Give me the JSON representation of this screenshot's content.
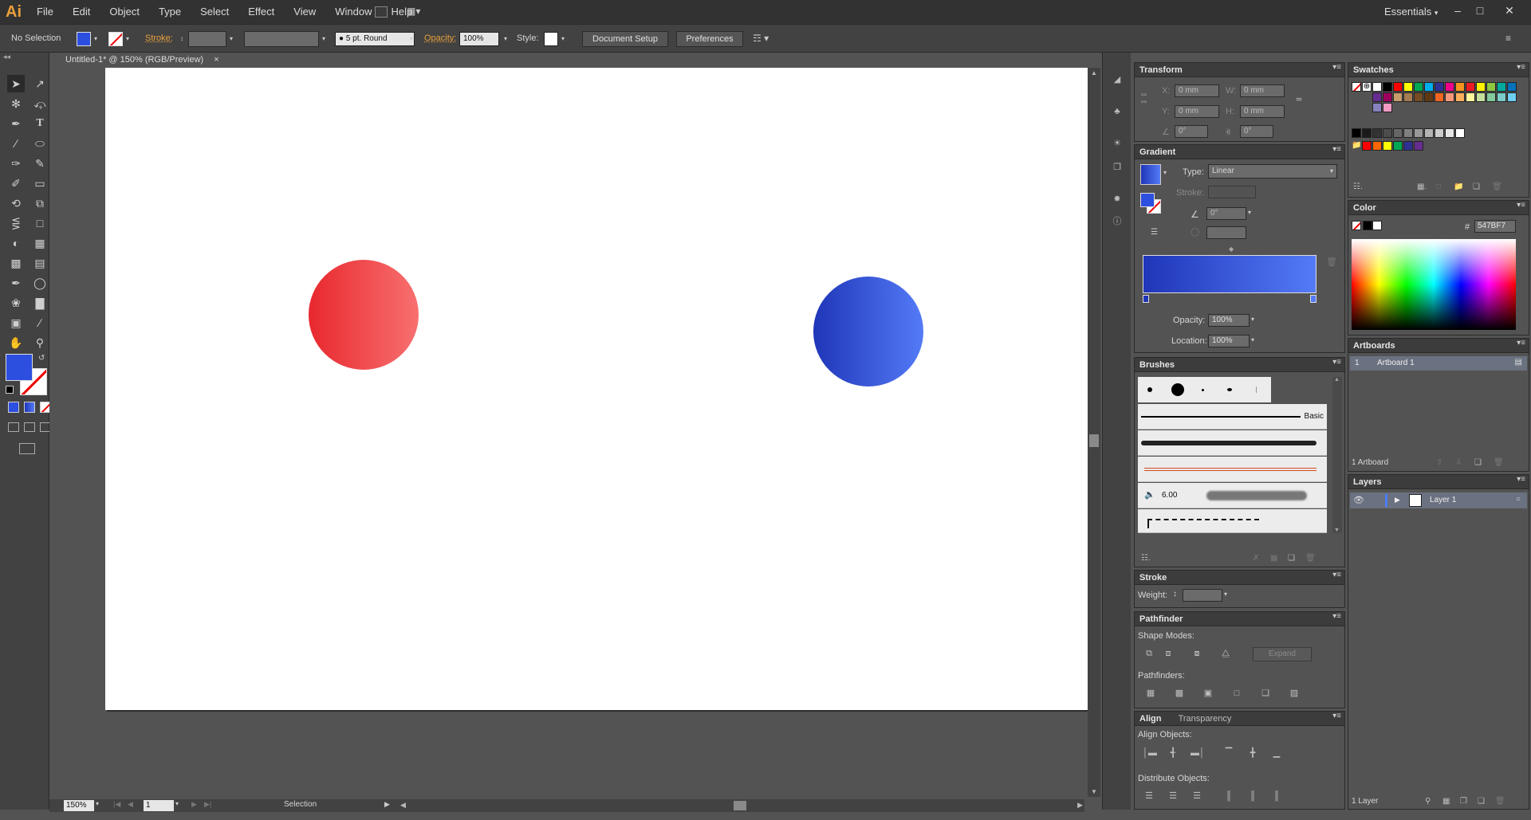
{
  "app": {
    "logo": "Ai",
    "menu": [
      "File",
      "Edit",
      "Object",
      "Type",
      "Select",
      "Effect",
      "View",
      "Window",
      "Help"
    ],
    "workspace": "Essentials",
    "window_buttons": [
      "–",
      "□",
      "✕"
    ]
  },
  "control_bar": {
    "selection": "No Selection",
    "stroke_label": "Stroke:",
    "brush": "5 pt. Round",
    "opacity_label": "Opacity:",
    "opacity_value": "100%",
    "style_label": "Style:",
    "document_setup": "Document Setup",
    "preferences": "Preferences"
  },
  "document": {
    "tab_title": "Untitled-1* @ 150% (RGB/Preview)",
    "close": "×",
    "zoom": "150%",
    "artboard_nav": "1",
    "status_tool": "Selection",
    "shapes": [
      {
        "name": "red-gradient-circle",
        "from": "#e8282e",
        "to": "#f87070"
      },
      {
        "name": "blue-gradient-circle",
        "from": "#1f36b8",
        "to": "#547bf7"
      }
    ]
  },
  "transform": {
    "title": "Transform",
    "x_label": "X:",
    "x_value": "0 mm",
    "y_label": "Y:",
    "y_value": "0 mm",
    "w_label": "W:",
    "w_value": "0 mm",
    "h_label": "H:",
    "h_value": "0 mm",
    "angle_value": "0°",
    "shear_value": "0°"
  },
  "gradient": {
    "title": "Gradient",
    "type_label": "Type:",
    "type_value": "Linear",
    "stroke_label": "Stroke:",
    "angle_value": "0°",
    "opacity_label": "Opacity:",
    "opacity_value": "100%",
    "location_label": "Location:",
    "location_value": "100%",
    "from": "#1f36b8",
    "to": "#547bf7"
  },
  "brushes": {
    "title": "Brushes",
    "basic_label": "Basic",
    "size_value": "6.00"
  },
  "stroke": {
    "title": "Stroke",
    "weight_label": "Weight:"
  },
  "pathfinder": {
    "title": "Pathfinder",
    "shape_modes": "Shape Modes:",
    "expand": "Expand",
    "pathfinders": "Pathfinders:"
  },
  "align": {
    "tab_align": "Align",
    "tab_transparency": "Transparency",
    "align_objects": "Align Objects:",
    "distribute_objects": "Distribute Objects:"
  },
  "swatches": {
    "title": "Swatches",
    "colors": [
      "#ffffff",
      "#000000",
      "#ff0000",
      "#ffff00",
      "#00a651",
      "#00aeef",
      "#2e3192",
      "#ec008c",
      "#f7941d",
      "#ed1c24",
      "#fff200",
      "#8dc63f",
      "#00a99d",
      "#0072bc",
      "#662d91",
      "#9e005d",
      "#c69c6d",
      "#a67c52",
      "#754c24",
      "#603913",
      "#f26522",
      "#f7977a",
      "#fbaf5d",
      "#fff799",
      "#c4df9b",
      "#82ca9c",
      "#7accc8",
      "#6dcff6",
      "#8781bd",
      "#f49ac2"
    ],
    "grays": [
      "#000000",
      "#1a1a1a",
      "#333333",
      "#4d4d4d",
      "#666666",
      "#808080",
      "#999999",
      "#b3b3b3",
      "#cccccc",
      "#e6e6e6",
      "#ffffff"
    ],
    "group": [
      "#ff0000",
      "#ff6600",
      "#ffff00",
      "#00a651",
      "#2e3192",
      "#662d91"
    ]
  },
  "color": {
    "title": "Color",
    "hex_label": "#",
    "hex_value": "547BF7"
  },
  "artboards": {
    "title": "Artboards",
    "row_number": "1",
    "row_name": "Artboard 1",
    "footer": "1 Artboard"
  },
  "layers": {
    "title": "Layers",
    "layer_name": "Layer 1",
    "footer": "1 Layer"
  }
}
